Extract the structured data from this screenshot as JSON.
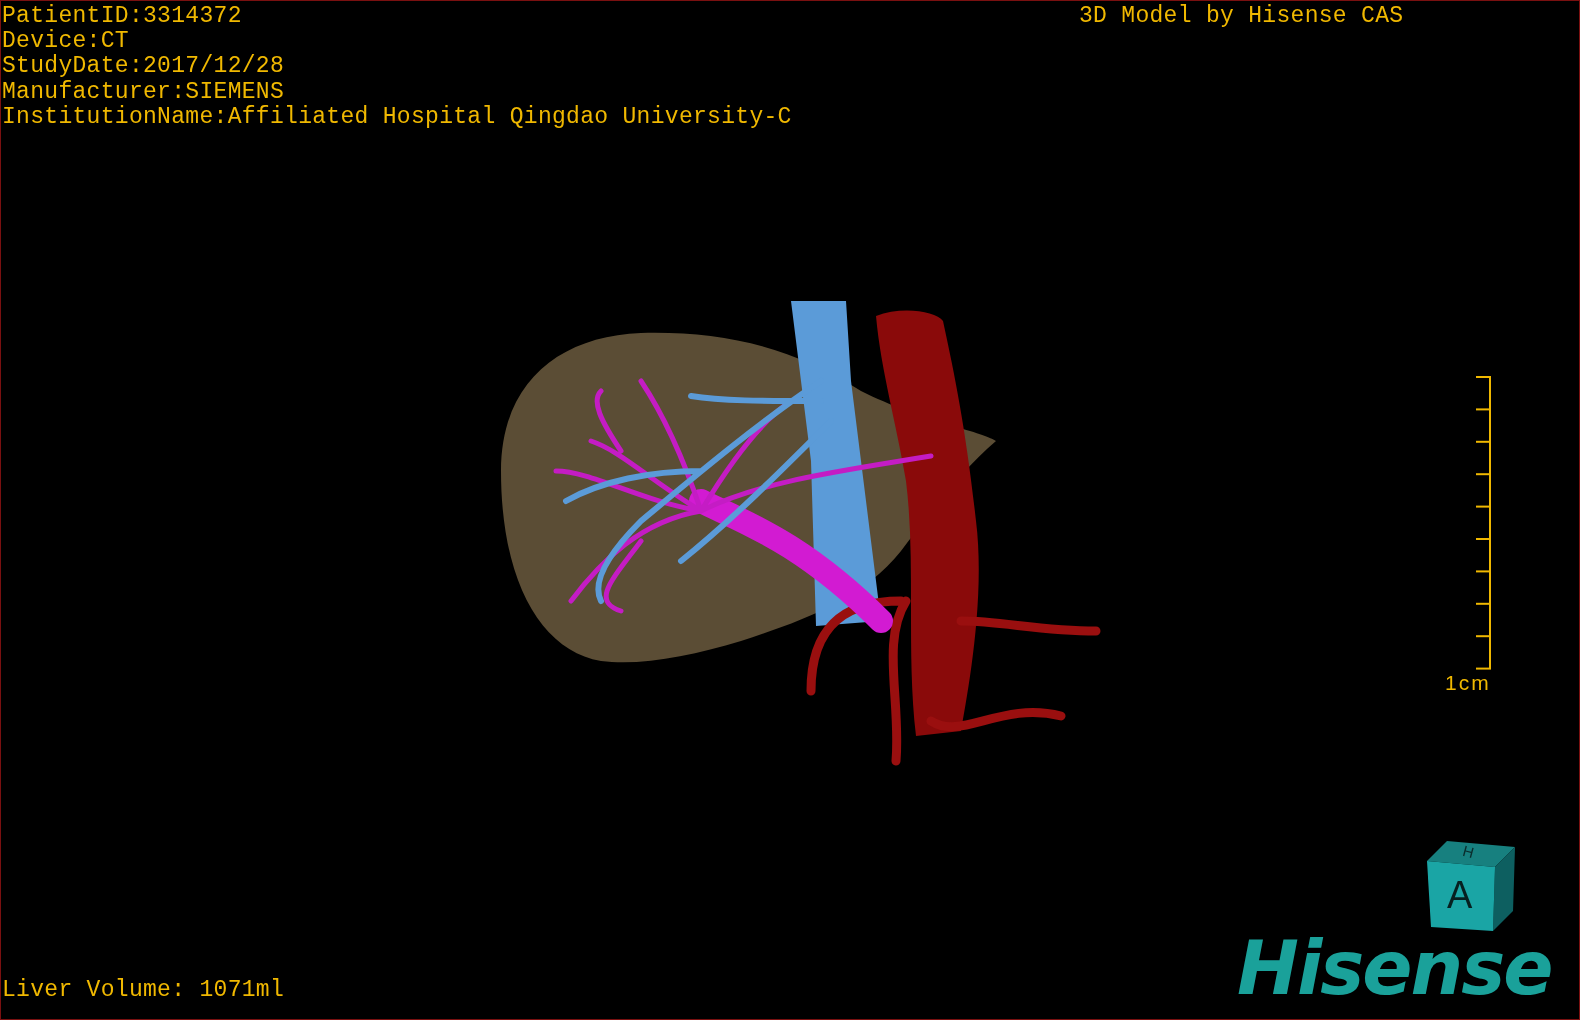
{
  "viewport": {
    "info_lines": [
      "PatientID:3314372",
      "Device:CT",
      "StudyDate:2017/12/28",
      "Manufacturer:SIEMENS",
      "InstitutionName:Affiliated Hospital Qingdao University-C"
    ],
    "title": "3D Model by Hisense CAS",
    "scale_bar": {
      "label": "1cm"
    },
    "orientation_cube": {
      "front": "A",
      "top": "H"
    },
    "logo": "Hisense",
    "liver_volume": "Liver Volume: 1071ml"
  }
}
